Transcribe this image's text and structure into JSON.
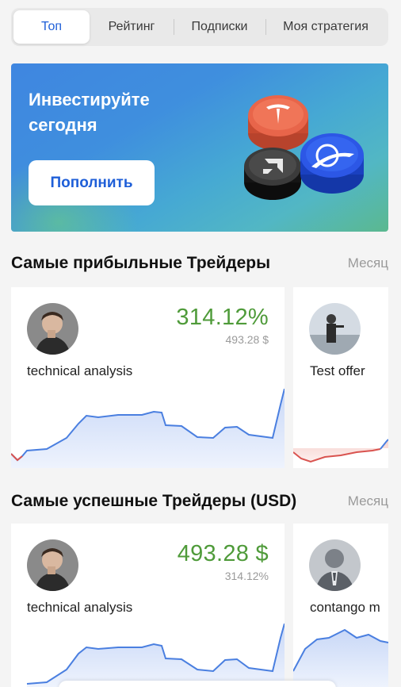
{
  "tabs": [
    {
      "label": "Топ",
      "active": true
    },
    {
      "label": "Рейтинг",
      "active": false
    },
    {
      "label": "Подписки",
      "active": false
    },
    {
      "label": "Моя стратегия",
      "active": false
    }
  ],
  "banner": {
    "title": "Инвестируйте сегодня",
    "button_label": "Пополнить",
    "icons": [
      "tesla-coin-icon",
      "amd-coin-icon",
      "boeing-coin-icon"
    ]
  },
  "sections": [
    {
      "title": "Самые прибыльные Трейдеры",
      "period_label": "Месяц",
      "cards": [
        {
          "name": "technical analysis",
          "main_value": "314.12%",
          "sub_value": "493.28 $",
          "chart_color": "#4a7fe0"
        },
        {
          "name": "Test offer",
          "main_value": "",
          "sub_value": "",
          "chart_color": "#d9534f"
        }
      ]
    },
    {
      "title": "Самые успешные Трейдеры (USD)",
      "period_label": "Месяц",
      "cards": [
        {
          "name": "technical analysis",
          "main_value": "493.28 $",
          "sub_value": "314.12%",
          "chart_color": "#4a7fe0"
        },
        {
          "name": "contango m",
          "main_value": "",
          "sub_value": "",
          "chart_color": "#4a7fe0"
        }
      ]
    }
  ],
  "colors": {
    "accent": "#1f5fd8",
    "positive": "#4f9b3a",
    "muted": "#9a9a9a"
  }
}
